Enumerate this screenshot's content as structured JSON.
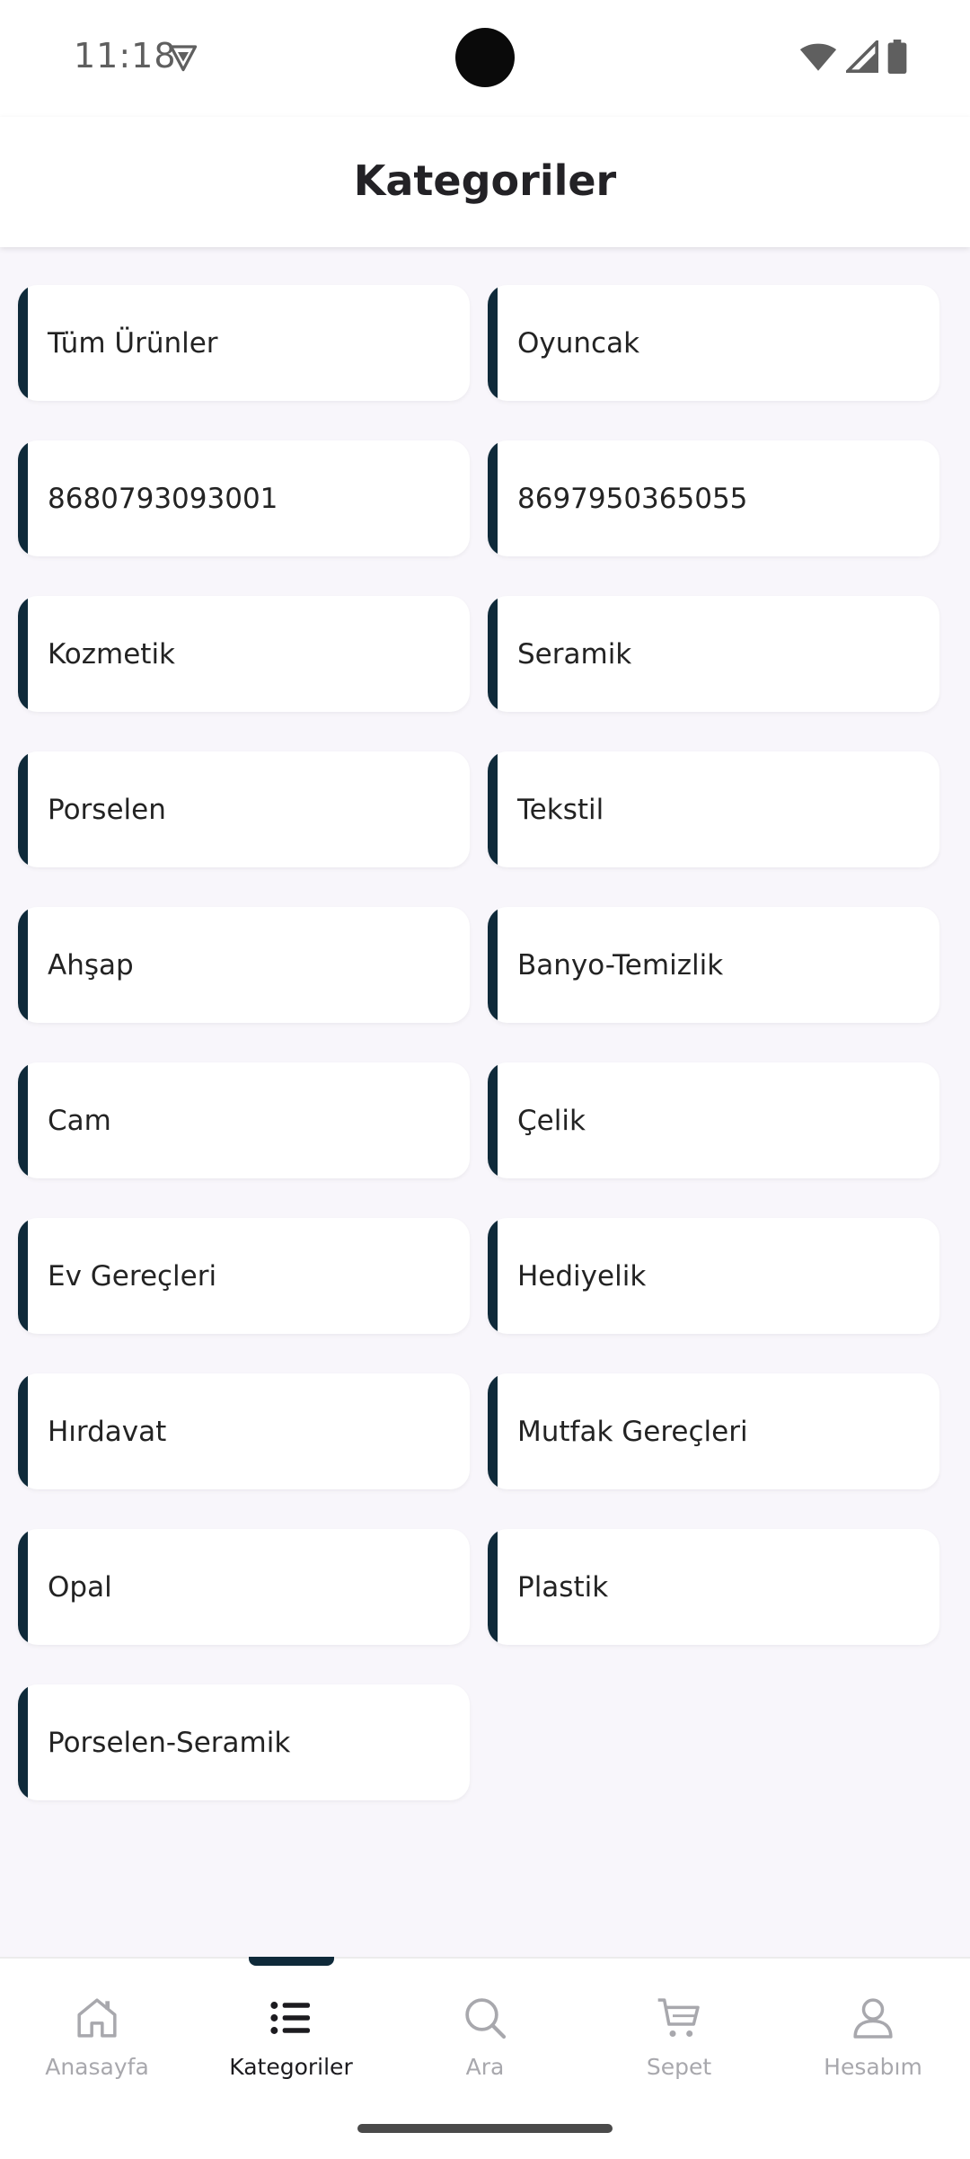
{
  "status_bar": {
    "time": "11:18",
    "icons": [
      "vpn-shield-icon",
      "wifi-icon",
      "cellular-signal-icon",
      "battery-icon"
    ]
  },
  "app_bar": {
    "title": "Kategoriler"
  },
  "categories": [
    {
      "label": "Tüm Ürünler"
    },
    {
      "label": "Oyuncak"
    },
    {
      "label": "8680793093001"
    },
    {
      "label": "8697950365055"
    },
    {
      "label": "Kozmetik"
    },
    {
      "label": "Seramik"
    },
    {
      "label": "Porselen"
    },
    {
      "label": "Tekstil"
    },
    {
      "label": "Ahşap"
    },
    {
      "label": "Banyo-Temizlik"
    },
    {
      "label": "Cam"
    },
    {
      "label": "Çelik"
    },
    {
      "label": "Ev Gereçleri"
    },
    {
      "label": "Hediyelik"
    },
    {
      "label": "Hırdavat"
    },
    {
      "label": "Mutfak Gereçleri"
    },
    {
      "label": "Opal"
    },
    {
      "label": "Plastik"
    },
    {
      "label": "Porselen-Seramik"
    }
  ],
  "bottom_nav": {
    "items": [
      {
        "label": "Anasayfa",
        "icon": "home-icon",
        "active": false
      },
      {
        "label": "Kategoriler",
        "icon": "list-icon",
        "active": true
      },
      {
        "label": "Ara",
        "icon": "search-icon",
        "active": false
      },
      {
        "label": "Sepet",
        "icon": "cart-icon",
        "active": false
      },
      {
        "label": "Hesabım",
        "icon": "account-icon",
        "active": false
      }
    ]
  },
  "colors": {
    "accent": "#0f2a3a",
    "page_background": "#f8f6fb",
    "card_background": "#ffffff",
    "nav_inactive": "#a8a8ad",
    "nav_active": "#1c1b1f"
  }
}
